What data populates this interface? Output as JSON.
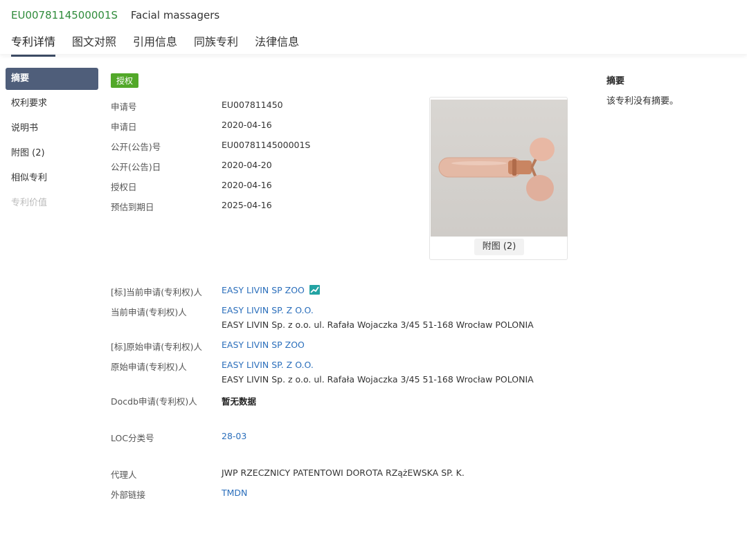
{
  "header": {
    "publication_number": "EU0078114500001S",
    "patent_title": "Facial massagers"
  },
  "tabs": [
    "专利详情",
    "图文对照",
    "引用信息",
    "同族专利",
    "法律信息"
  ],
  "sidenav": [
    "摘要",
    "权利要求",
    "说明书",
    "附图 (2)",
    "相似专利",
    "专利价值"
  ],
  "status_badge": "授权",
  "fields": {
    "application_no": {
      "label": "申请号",
      "value": "EU007811450"
    },
    "application_date": {
      "label": "申请日",
      "value": "2020-04-16"
    },
    "publication_no": {
      "label": "公开(公告)号",
      "value": "EU0078114500001S"
    },
    "publication_date": {
      "label": "公开(公告)日",
      "value": "2020-04-20"
    },
    "grant_date": {
      "label": "授权日",
      "value": "2020-04-16"
    },
    "expiry_date": {
      "label": "预估到期日",
      "value": "2025-04-16"
    },
    "std_current_applicant": {
      "label": "[标]当前申请(专利权)人",
      "value": "EASY LIVIN SP ZOO"
    },
    "current_applicant": {
      "label": "当前申请(专利权)人",
      "value": "EASY LIVIN SP. Z O.O.",
      "address": "EASY LIVIN Sp. z o.o. ul. Rafała Wojaczka 3/45 51-168 Wrocław POLONIA"
    },
    "std_original_applicant": {
      "label": "[标]原始申请(专利权)人",
      "value": "EASY LIVIN SP ZOO"
    },
    "original_applicant": {
      "label": "原始申请(专利权)人",
      "value": "EASY LIVIN SP. Z O.O.",
      "address": "EASY LIVIN Sp. z o.o. ul. Rafała Wojaczka 3/45 51-168 Wrocław POLONIA"
    },
    "docdb_applicant": {
      "label": "Docdb申请(专利权)人",
      "value": "暂无数据"
    },
    "loc_class": {
      "label": "LOC分类号",
      "value": "28-03"
    },
    "agent": {
      "label": "代理人",
      "value": "JWP RZECZNICY PATENTOWI DOROTA RZążEWSKA SP. K."
    },
    "external_link": {
      "label": "外部链接",
      "value": "TMDN"
    }
  },
  "figure": {
    "button_label": "附图 (2)"
  },
  "abstract": {
    "title": "摘要",
    "text": "该专利没有摘要。"
  },
  "colors": {
    "pub_no": "#2e8b3a",
    "badge": "#52a829",
    "link": "#2a6ebb",
    "nav_active": "#4f5e7a"
  }
}
